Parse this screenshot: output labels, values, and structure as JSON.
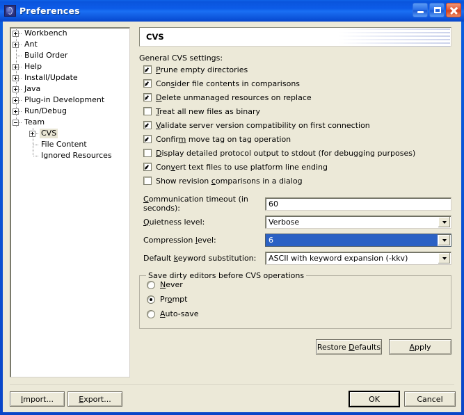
{
  "window": {
    "title": "Preferences",
    "icon": "eclipse-icon",
    "caption_buttons": [
      {
        "name": "minimize-button",
        "glyph": "minimize-icon"
      },
      {
        "name": "maximize-button",
        "glyph": "maximize-icon"
      },
      {
        "name": "close-button",
        "glyph": "close-icon"
      }
    ],
    "accent_color": "#0a54dc",
    "face_color": "#ece9d8"
  },
  "sidebar": {
    "items": [
      {
        "label": "Workbench",
        "expander": "plus",
        "level": 0,
        "selected": false
      },
      {
        "label": "Ant",
        "expander": "plus",
        "level": 0,
        "selected": false
      },
      {
        "label": "Build Order",
        "expander": "none",
        "level": 0,
        "selected": false
      },
      {
        "label": "Help",
        "expander": "plus",
        "level": 0,
        "selected": false
      },
      {
        "label": "Install/Update",
        "expander": "plus",
        "level": 0,
        "selected": false
      },
      {
        "label": "Java",
        "expander": "plus",
        "level": 0,
        "selected": false
      },
      {
        "label": "Plug-in Development",
        "expander": "plus",
        "level": 0,
        "selected": false
      },
      {
        "label": "Run/Debug",
        "expander": "plus",
        "level": 0,
        "selected": false
      },
      {
        "label": "Team",
        "expander": "minus",
        "level": 0,
        "selected": false
      },
      {
        "label": "CVS",
        "expander": "plus",
        "level": 1,
        "selected": true
      },
      {
        "label": "File Content",
        "expander": "none",
        "level": 1,
        "selected": false
      },
      {
        "label": "Ignored Resources",
        "expander": "none",
        "level": 1,
        "selected": false
      }
    ]
  },
  "page": {
    "banner_title": "CVS",
    "section_label": "General CVS settings:",
    "checkboxes": [
      {
        "label": "Prune empty directories",
        "checked": true,
        "mnemonic": "P"
      },
      {
        "label": "Consider file contents in comparisons",
        "checked": true,
        "mnemonic": "s"
      },
      {
        "label": "Delete unmanaged resources on replace",
        "checked": true,
        "mnemonic": "D"
      },
      {
        "label": "Treat all new files as binary",
        "checked": false,
        "mnemonic": "T"
      },
      {
        "label": "Validate server version compatibility on first connection",
        "checked": true,
        "mnemonic": "V"
      },
      {
        "label": "Confirm move tag on tag operation",
        "checked": true,
        "mnemonic": "m"
      },
      {
        "label": "Display detailed protocol output to stdout (for debugging purposes)",
        "checked": false,
        "mnemonic": "D"
      },
      {
        "label": "Convert text files to use platform line ending",
        "checked": true,
        "mnemonic": "v"
      },
      {
        "label": "Show revision comparisons in a dialog",
        "checked": false,
        "mnemonic": "c"
      }
    ],
    "fields": [
      {
        "label": "Communication timeout (in seconds):",
        "value": "60",
        "type": "text",
        "focused": false
      },
      {
        "label": "Quietness level:",
        "value": "Verbose",
        "type": "combo",
        "focused": false
      },
      {
        "label": "Compression level:",
        "value": "6",
        "type": "combo",
        "focused": true
      },
      {
        "label": "Default keyword substitution:",
        "value": "ASCII with keyword expansion (-kkv)",
        "type": "combo",
        "focused": false
      }
    ],
    "group": {
      "title": "Save dirty editors before CVS operations",
      "options": [
        {
          "label": "Never",
          "selected": false
        },
        {
          "label": "Prompt",
          "selected": true
        },
        {
          "label": "Auto-save",
          "selected": false
        }
      ]
    },
    "restore_defaults_label": "Restore Defaults",
    "apply_label": "Apply"
  },
  "footer": {
    "import_label": "Import...",
    "export_label": "Export...",
    "ok_label": "OK",
    "cancel_label": "Cancel"
  }
}
